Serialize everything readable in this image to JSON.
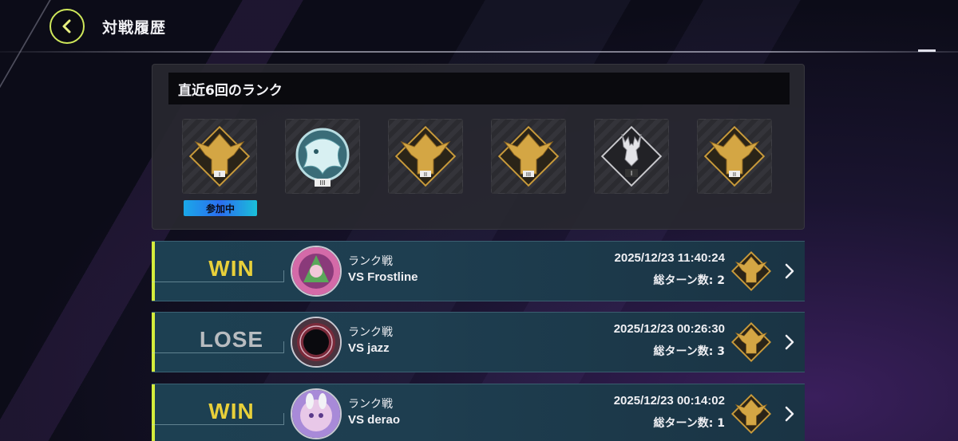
{
  "header": {
    "title": "対戦履歴",
    "back_icon": "chevron-left-icon"
  },
  "recent_ranks": {
    "title": "直近6回のランク",
    "current_badge": "参加中",
    "tiles": [
      {
        "icon": "gold-phoenix-rank-icon",
        "tier": "I"
      },
      {
        "icon": "platinum-dragon-rank-icon",
        "tier": "III"
      },
      {
        "icon": "gold-phoenix-rank-icon",
        "tier": "II"
      },
      {
        "icon": "gold-phoenix-rank-icon",
        "tier": "III"
      },
      {
        "icon": "silver-stag-rank-icon",
        "tier": "I"
      },
      {
        "icon": "gold-phoenix-rank-icon",
        "tier": "II"
      }
    ]
  },
  "matches": [
    {
      "result": "WIN",
      "type": "ランク戦",
      "opponent": "VS Frostline",
      "datetime": "2025/12/23 11:40:24",
      "turns": "総ターン数: 2",
      "avatar_icon": "pink-spellcaster-avatar-icon",
      "rank_icon": "gold-phoenix-rank-icon"
    },
    {
      "result": "LOSE",
      "type": "ランク戦",
      "opponent": "VS jazz",
      "datetime": "2025/12/23 00:26:30",
      "turns": "総ターン数: 3",
      "avatar_icon": "dark-orb-avatar-icon",
      "rank_icon": "gold-phoenix-rank-icon"
    },
    {
      "result": "WIN",
      "type": "ランク戦",
      "opponent": "VS derao",
      "datetime": "2025/12/23 00:14:02",
      "turns": "総ターン数: 1",
      "avatar_icon": "purple-rabbit-avatar-icon",
      "rank_icon": "gold-phoenix-rank-icon"
    }
  ],
  "colors": {
    "accent": "#d4ec3c",
    "win": "#e8d03a",
    "lose": "#b8bcc0",
    "row_bg": "#1d4052",
    "gold": "#c89a3a"
  }
}
